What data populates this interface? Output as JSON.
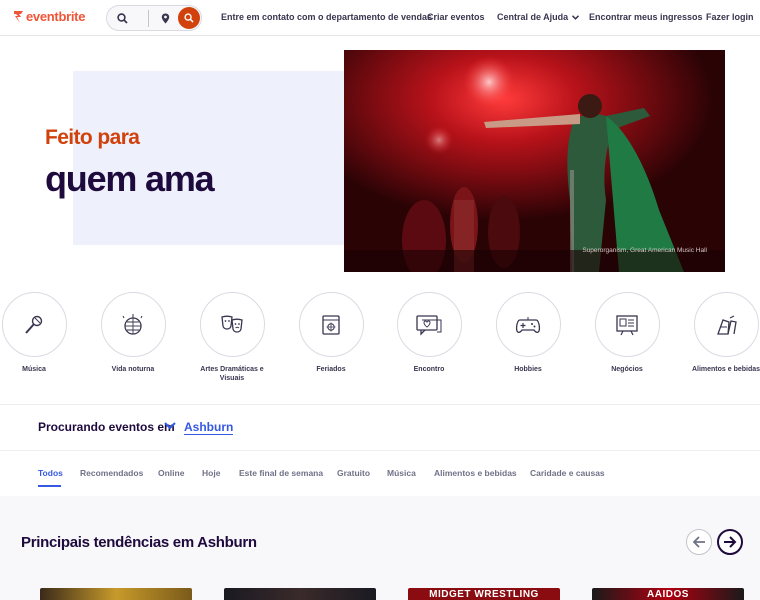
{
  "brand": {
    "name": "eventbrite",
    "color": "#f05537"
  },
  "header": {
    "search_icon": "search-icon",
    "location_icon": "location-pin-icon",
    "submit_icon": "search-icon",
    "nav": [
      {
        "label": "Entre em contato com o departamento de vendas"
      },
      {
        "label": "Criar eventos"
      },
      {
        "label": "Central de Ajuda",
        "icon": "chevron-down-icon"
      },
      {
        "label": "Encontrar meus ingressos"
      },
      {
        "label": "Fazer login"
      }
    ]
  },
  "hero": {
    "line1": "Feito para",
    "line2": "quem ama",
    "caption": "Superorganism, Great American Music Hall"
  },
  "categories": [
    {
      "label": "Música",
      "icon": "microphone-icon"
    },
    {
      "label": "Vida noturna",
      "icon": "disco-ball-icon"
    },
    {
      "label": "Artes Dramáticas e Visuais",
      "icon": "theater-masks-icon"
    },
    {
      "label": "Feriados",
      "icon": "calendar-icon"
    },
    {
      "label": "Encontro",
      "icon": "chat-heart-icon"
    },
    {
      "label": "Hobbies",
      "icon": "game-controller-icon"
    },
    {
      "label": "Negócios",
      "icon": "presentation-icon"
    },
    {
      "label": "Alimentos e bebidas",
      "icon": "food-drink-icon"
    }
  ],
  "location": {
    "label": "Procurando eventos em",
    "city": "Ashburn",
    "icon": "chevron-down-icon"
  },
  "tabs": [
    {
      "label": "Todos",
      "active": true
    },
    {
      "label": "Recomendados"
    },
    {
      "label": "Online"
    },
    {
      "label": "Hoje"
    },
    {
      "label": "Este final de semana"
    },
    {
      "label": "Gratuito"
    },
    {
      "label": "Música"
    },
    {
      "label": "Alimentos e bebidas"
    },
    {
      "label": "Caridade e causas"
    }
  ],
  "trending": {
    "title": "Principais tendências em Ashburn",
    "prev_icon": "arrow-left-icon",
    "next_icon": "arrow-right-icon",
    "cards": [
      {
        "text": ""
      },
      {
        "text": ""
      },
      {
        "text": "MIDGET WRESTLING"
      },
      {
        "text": "AAIDOS"
      }
    ]
  },
  "colors": {
    "accent": "#d1410c",
    "link": "#3659e3",
    "text": "#1e0a3c"
  }
}
